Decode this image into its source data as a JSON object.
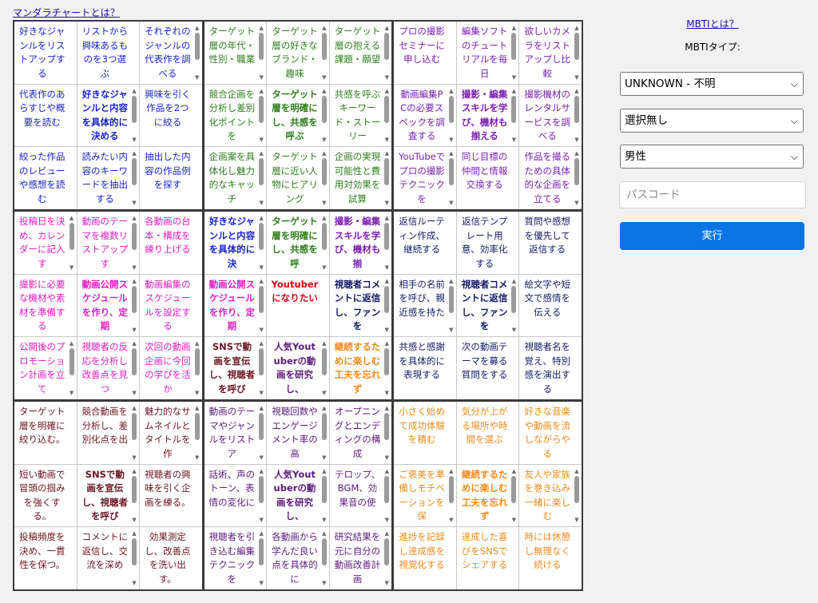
{
  "top_link": "マンダラチャートとは？",
  "panel": {
    "mbti_link": "MBTIとは？",
    "mbti_label": "MBTIタイプ:",
    "mbti_select": "UNKNOWN - 不明",
    "free_select": "選択無し",
    "gender_select": "男性",
    "passcode_placeholder": "パスコード",
    "run_button": "実行"
  },
  "colors": {
    "blue": "#1b23c8",
    "purple": "#7a1fae",
    "green": "#2e7d1c",
    "magenta": "#e01ec2",
    "navy": "#121a66",
    "red": "#e0000f",
    "brown": "#6a1420",
    "orange": "#f08a1a",
    "run_button": "#0b75e6"
  },
  "grid": {
    "blocks": [
      {
        "cells": [
          {
            "text": "好きなジャンルをリストアップする",
            "color": "blue",
            "bold": false,
            "scroll": false
          },
          {
            "text": "リストから興味あるものを3つ選ぶ",
            "color": "blue",
            "bold": false,
            "scroll": false
          },
          {
            "text": "それぞれのジャンルの代表作を調べる",
            "color": "blue",
            "bold": false,
            "scroll": true
          },
          {
            "text": "代表作のあらすじや概要を読む",
            "color": "blue",
            "bold": false,
            "scroll": false
          },
          {
            "text": "好きなジャンルと内容を具体的に決める",
            "color": "blue",
            "bold": true,
            "scroll": true
          },
          {
            "text": "興味を引く作品を2つに絞る",
            "color": "blue",
            "bold": false,
            "scroll": false
          },
          {
            "text": "絞った作品のレビューや感想を読む",
            "color": "blue",
            "bold": false,
            "scroll": false
          },
          {
            "text": "読みたい内容のキーワードを抽出する",
            "color": "blue",
            "bold": false,
            "scroll": true
          },
          {
            "text": "抽出した内容の作品例を探す",
            "color": "blue",
            "bold": false,
            "scroll": false
          }
        ]
      },
      {
        "cells": [
          {
            "text": "ターゲット層の年代・性別・職業",
            "color": "green",
            "bold": false,
            "scroll": true
          },
          {
            "text": "ターゲット層の好きなブランド・趣味",
            "color": "green",
            "bold": false,
            "scroll": true
          },
          {
            "text": "ターゲット層の抱える課題・願望",
            "color": "green",
            "bold": false,
            "scroll": true
          },
          {
            "text": "競合企画を分析し差別化ポイントを",
            "color": "green",
            "bold": false,
            "scroll": true
          },
          {
            "text": "ターゲット層を明確にし、共感を呼ぶ",
            "color": "green",
            "bold": true,
            "scroll": true
          },
          {
            "text": "共感を呼ぶキーワード・ストーリー",
            "color": "green",
            "bold": false,
            "scroll": true
          },
          {
            "text": "企画案を具体化し魅力的なキャッチ",
            "color": "green",
            "bold": false,
            "scroll": true
          },
          {
            "text": "ターゲット層に近い人物にヒアリング",
            "color": "green",
            "bold": false,
            "scroll": true
          },
          {
            "text": "企画の実現可能性と費用対効果を試算",
            "color": "green",
            "bold": false,
            "scroll": true
          }
        ]
      },
      {
        "cells": [
          {
            "text": "プロの撮影セミナーに申し込む",
            "color": "purple",
            "bold": false,
            "scroll": false
          },
          {
            "text": "編集ソフトのチュートリアルを毎日",
            "color": "purple",
            "bold": false,
            "scroll": true
          },
          {
            "text": "欲しいカメラをリストアップし比較",
            "color": "purple",
            "bold": false,
            "scroll": true
          },
          {
            "text": "動画編集PCの必要スペックを調査する",
            "color": "purple",
            "bold": false,
            "scroll": true
          },
          {
            "text": "撮影・編集スキルを学び、機材も揃える",
            "color": "purple",
            "bold": true,
            "scroll": true
          },
          {
            "text": "撮影機材のレンタルサービスを調べる",
            "color": "purple",
            "bold": false,
            "scroll": true
          },
          {
            "text": "YouTubeでプロの撮影テクニックを",
            "color": "purple",
            "bold": false,
            "scroll": true
          },
          {
            "text": "同じ目標の仲間と情報交換する",
            "color": "purple",
            "bold": false,
            "scroll": false
          },
          {
            "text": "作品を撮るための具体的な企画を立てる",
            "color": "purple",
            "bold": false,
            "scroll": true
          }
        ]
      },
      {
        "cells": [
          {
            "text": "投稿日を決め、カレンダーに記入す",
            "color": "magenta",
            "bold": false,
            "scroll": true
          },
          {
            "text": "動画のテーマを複数リストアップす",
            "color": "magenta",
            "bold": false,
            "scroll": true
          },
          {
            "text": "各動画の台本・構成を練り上げる",
            "color": "magenta",
            "bold": false,
            "scroll": false
          },
          {
            "text": "撮影に必要な機材や素材を準備する",
            "color": "magenta",
            "bold": false,
            "scroll": false
          },
          {
            "text": "動画公開スケジュールを作り、定期",
            "color": "magenta",
            "bold": true,
            "scroll": true
          },
          {
            "text": "動画編集のスケジュールを設定する",
            "color": "magenta",
            "bold": false,
            "scroll": false
          },
          {
            "text": "公開後のプロモーション計画を立て",
            "color": "magenta",
            "bold": false,
            "scroll": true
          },
          {
            "text": "視聴者の反応を分析し改善点を見つ",
            "color": "magenta",
            "bold": false,
            "scroll": true
          },
          {
            "text": "次回の動画企画に今回の学びを活か",
            "color": "magenta",
            "bold": false,
            "scroll": true
          }
        ]
      },
      {
        "cells": [
          {
            "text": "好きなジャンルと内容を具体的に決",
            "color": "blue",
            "bold": true,
            "scroll": true
          },
          {
            "text": "ターゲット層を明確にし、共感を呼",
            "color": "green",
            "bold": true,
            "scroll": true
          },
          {
            "text": "撮影・編集スキルを学び、機材も揃",
            "color": "purple",
            "bold": true,
            "scroll": true
          },
          {
            "text": "動画公開スケジュールを作り、定期",
            "color": "magenta",
            "bold": true,
            "scroll": true
          },
          {
            "text": "Youtuberになりたい",
            "color": "red",
            "bold": true,
            "scroll": false
          },
          {
            "text": "視聴者コメントに返信し、ファンを",
            "color": "navy",
            "bold": true,
            "scroll": true
          },
          {
            "text": "SNSで動画を宣伝し、視聴者を呼び",
            "color": "brown",
            "bold": true,
            "scroll": true
          },
          {
            "text": "人気Youtuberの動画を研究し、",
            "color": "grape",
            "bold": true,
            "scroll": true
          },
          {
            "text": "継続するために楽しむ工夫を忘れず",
            "color": "orange",
            "bold": true,
            "scroll": true
          }
        ]
      },
      {
        "cells": [
          {
            "text": "返信ルーティン作成、継続する",
            "color": "navy",
            "bold": false,
            "scroll": false
          },
          {
            "text": "返信テンプレート用意、効率化する",
            "color": "navy",
            "bold": false,
            "scroll": false
          },
          {
            "text": "質問や感想を優先して返信する",
            "color": "navy",
            "bold": false,
            "scroll": false
          },
          {
            "text": "相手の名前を呼び、親近感を持た",
            "color": "navy",
            "bold": false,
            "scroll": true
          },
          {
            "text": "視聴者コメントに返信し、ファンを",
            "color": "navy",
            "bold": true,
            "scroll": true
          },
          {
            "text": "絵文字や短文で感情を伝える",
            "color": "navy",
            "bold": false,
            "scroll": false
          },
          {
            "text": "共感と感謝を具体的に表現する",
            "color": "navy",
            "bold": false,
            "scroll": false
          },
          {
            "text": "次の動画テーマを募る質問をする",
            "color": "navy",
            "bold": false,
            "scroll": false
          },
          {
            "text": "視聴者名を覚え、特別感を演出する",
            "color": "navy",
            "bold": false,
            "scroll": false
          }
        ]
      },
      {
        "cells": [
          {
            "text": "ターゲット層を明確に絞り込む。",
            "color": "brown",
            "bold": false,
            "scroll": false
          },
          {
            "text": "競合動画を分析し、差別化点を出",
            "color": "brown",
            "bold": false,
            "scroll": true
          },
          {
            "text": "魅力的なサムネイルとタイトルを作",
            "color": "brown",
            "bold": false,
            "scroll": true
          },
          {
            "text": "短い動画で冒頭の掴みを強くする。",
            "color": "brown",
            "bold": false,
            "scroll": false
          },
          {
            "text": "SNSで動画を宣伝し、視聴者を呼び",
            "color": "brown",
            "bold": true,
            "scroll": true
          },
          {
            "text": "視聴者の興味を引く企画を練る。",
            "color": "brown",
            "bold": false,
            "scroll": false
          },
          {
            "text": "投稿頻度を決め、一貫性を保つ。",
            "color": "brown",
            "bold": false,
            "scroll": false
          },
          {
            "text": "コメントに返信し、交流を深め",
            "color": "brown",
            "bold": false,
            "scroll": true
          },
          {
            "text": "効果測定し、改善点を洗い出す。",
            "color": "brown",
            "bold": false,
            "scroll": false
          }
        ]
      },
      {
        "cells": [
          {
            "text": "動画のテーマやジャンルをリストア",
            "color": "grape",
            "bold": false,
            "scroll": true
          },
          {
            "text": "視聴回数やエンゲージメント率の高",
            "color": "grape",
            "bold": false,
            "scroll": true
          },
          {
            "text": "オープニングとエンディングの構成",
            "color": "grape",
            "bold": false,
            "scroll": true
          },
          {
            "text": "話術、声のトーン、表情の変化に",
            "color": "grape",
            "bold": false,
            "scroll": true
          },
          {
            "text": "人気Youtuberの動画を研究し、",
            "color": "grape",
            "bold": true,
            "scroll": true
          },
          {
            "text": "テロップ、BGM、効果音の使",
            "color": "grape",
            "bold": false,
            "scroll": true
          },
          {
            "text": "視聴者を引き込む編集テクニックを",
            "color": "grape",
            "bold": false,
            "scroll": true
          },
          {
            "text": "各動画から学んだ良い点を具体的に",
            "color": "grape",
            "bold": false,
            "scroll": true
          },
          {
            "text": "研究結果を元に自分の動画改善計画",
            "color": "grape",
            "bold": false,
            "scroll": true
          }
        ]
      },
      {
        "cells": [
          {
            "text": "小さく始めて成功体験を積む",
            "color": "orange",
            "bold": false,
            "scroll": false
          },
          {
            "text": "気分が上がる場所や時間を選ぶ",
            "color": "orange",
            "bold": false,
            "scroll": false
          },
          {
            "text": "好きな音楽や動画を流しながらやる",
            "color": "orange",
            "bold": false,
            "scroll": false
          },
          {
            "text": "ご褒美を準備しモチベーションを保",
            "color": "orange",
            "bold": false,
            "scroll": true
          },
          {
            "text": "継続するために楽しむ工夫を忘れず",
            "color": "orange",
            "bold": true,
            "scroll": true
          },
          {
            "text": "友人や家族を巻き込み一緒に楽しむ",
            "color": "orange",
            "bold": false,
            "scroll": true
          },
          {
            "text": "進捗を記録し達成感を視覚化する",
            "color": "orange",
            "bold": false,
            "scroll": false
          },
          {
            "text": "達成した喜びをSNSでシェアする",
            "color": "orange",
            "bold": false,
            "scroll": false
          },
          {
            "text": "時には休憩し無理なく続ける",
            "color": "orange",
            "bold": false,
            "scroll": false
          }
        ]
      }
    ]
  }
}
